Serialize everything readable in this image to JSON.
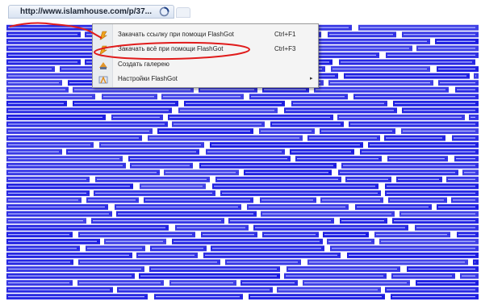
{
  "browser": {
    "tab_title": "http://www.islamhouse.com/p/37...",
    "tab_icon": "loading-spinner-icon",
    "new_tab_icon": "new-tab-icon"
  },
  "page": {
    "link_prefix": "http://www.islamhouse.com",
    "link_text_sample": "http://www.islamhouse.com/data/quran/Maher_Al-Muaiqly/Quran_Maher_Al-Muaiqly-001.mp3",
    "link_color": "#1a1ae0"
  },
  "context_menu": {
    "items": [
      {
        "label": "Закачать ссылку при помощи FlashGot",
        "shortcut": "Ctrl+F1",
        "icon": "flashgot-icon"
      },
      {
        "label": "Закачать всё при помощи FlashGot",
        "shortcut": "Ctrl+F3",
        "icon": "flashgot-icon"
      },
      {
        "label": "Создать галерею",
        "shortcut": "",
        "icon": "gallery-icon"
      },
      {
        "label": "Настройки FlashGot",
        "shortcut": "",
        "icon": "settings-icon",
        "submenu_arrow": "▸"
      }
    ]
  },
  "annotations": {
    "stroke_color": "#e01b1b"
  }
}
